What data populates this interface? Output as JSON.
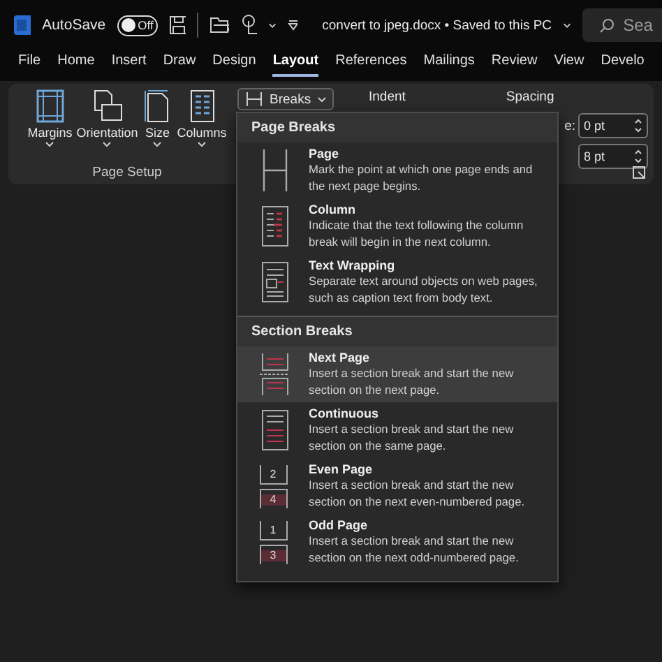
{
  "titlebar": {
    "autosave_label": "AutoSave",
    "autosave": {
      "label": "Off",
      "on": false
    },
    "document_title": "convert to jpeg.docx • Saved to this PC",
    "search_placeholder": "Sea"
  },
  "tabs": [
    {
      "label": "File",
      "selected": false
    },
    {
      "label": "Home",
      "selected": false
    },
    {
      "label": "Insert",
      "selected": false
    },
    {
      "label": "Draw",
      "selected": false
    },
    {
      "label": "Design",
      "selected": false
    },
    {
      "label": "Layout",
      "selected": true
    },
    {
      "label": "References",
      "selected": false
    },
    {
      "label": "Mailings",
      "selected": false
    },
    {
      "label": "Review",
      "selected": false
    },
    {
      "label": "View",
      "selected": false
    },
    {
      "label": "Develo",
      "selected": false
    }
  ],
  "ribbon": {
    "page_setup": {
      "buttons": [
        {
          "kind": "margins",
          "label": "Margins"
        },
        {
          "kind": "orientation",
          "label": "Orientation"
        },
        {
          "kind": "size",
          "label": "Size"
        },
        {
          "kind": "columns",
          "label": "Columns"
        }
      ],
      "group_label": "Page Setup"
    },
    "breaks_button": "Breaks",
    "indent_label": "Indent",
    "spacing_label": "Spacing",
    "fields": [
      {
        "label": "e:",
        "value": "0 pt"
      },
      {
        "value": "8 pt"
      }
    ]
  },
  "breaks_menu": {
    "sections": [
      {
        "header": "Page Breaks",
        "items": [
          {
            "kind": "page",
            "title": "Page",
            "description": "Mark the point at which one page ends and the next page begins.",
            "selected": false
          },
          {
            "kind": "column",
            "title": "Column",
            "description": "Indicate that the text following the column break will begin in the next column.",
            "selected": false
          },
          {
            "kind": "wrapping",
            "title": "Text Wrapping",
            "description": "Separate text around objects on web pages, such as caption text from body text.",
            "selected": false
          }
        ]
      },
      {
        "header": "Section Breaks",
        "items": [
          {
            "kind": "next",
            "title": "Next Page",
            "description": "Insert a section break and start the new section on the next page.",
            "selected": true
          },
          {
            "kind": "continuous",
            "title": "Continuous",
            "description": "Insert a section break and start the new section on the same page.",
            "selected": false
          },
          {
            "kind": "numbered",
            "title": "Even Page",
            "description": "Insert a section break and start the new section on the next even-numbered page.",
            "icon_digits": [
              "2",
              "4"
            ],
            "selected": false
          },
          {
            "kind": "numbered",
            "title": "Odd Page",
            "description": "Insert a section break and start the new section on the next odd-numbered page.",
            "icon_digits": [
              "1",
              "3"
            ],
            "selected": false
          }
        ]
      }
    ]
  }
}
